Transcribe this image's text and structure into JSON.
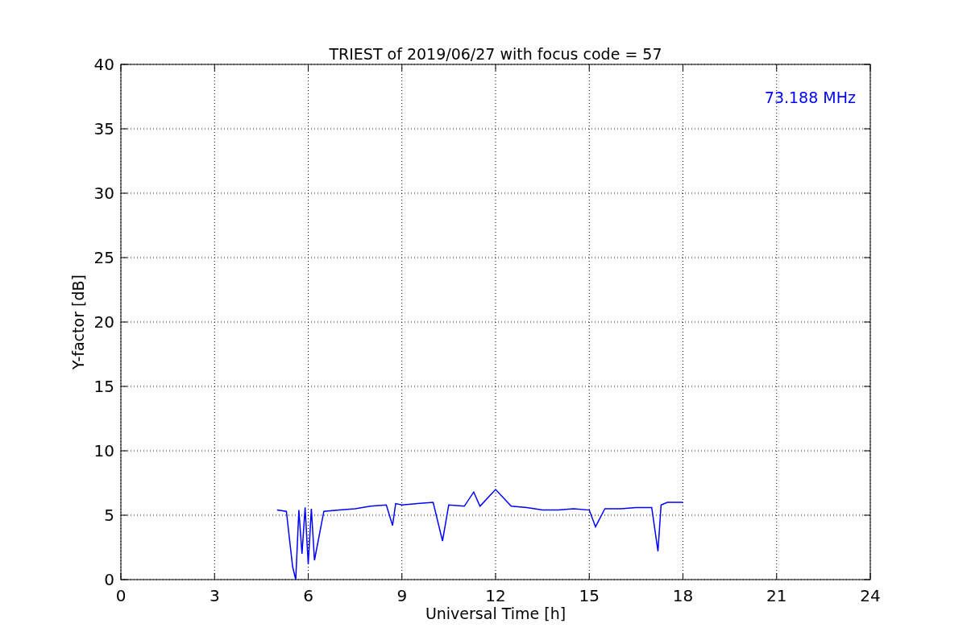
{
  "figure": {
    "chart_data": {
      "type": "line",
      "title": "TRIEST of 2019/06/27 with focus code = 57",
      "xlabel": "Universal Time [h]",
      "ylabel": "Y-factor [dB]",
      "x": [
        5.0,
        5.3,
        5.5,
        5.6,
        5.7,
        5.8,
        5.9,
        6.0,
        6.1,
        6.2,
        6.5,
        7.0,
        7.5,
        8.0,
        8.5,
        8.7,
        8.8,
        9.0,
        9.5,
        10.0,
        10.3,
        10.5,
        11.0,
        11.3,
        11.5,
        12.0,
        12.5,
        13.0,
        13.5,
        14.0,
        14.5,
        15.0,
        15.2,
        15.5,
        16.0,
        16.5,
        17.0,
        17.2,
        17.3,
        17.5,
        18.0
      ],
      "grid": true,
      "series": [
        {
          "color": "#0000ff",
          "values": [
            5.4,
            5.3,
            1.0,
            0,
            5.4,
            2.0,
            5.6,
            1.2,
            5.5,
            1.5,
            5.3,
            5.4,
            5.5,
            5.7,
            5.8,
            4.2,
            5.9,
            5.8,
            5.9,
            6.0,
            3.0,
            5.8,
            5.7,
            6.8,
            5.7,
            7.0,
            5.7,
            5.6,
            5.4,
            5.4,
            5.5,
            5.4,
            4.1,
            5.5,
            5.5,
            5.6,
            5.6,
            2.2,
            5.8,
            6.0,
            6.0
          ]
        }
      ],
      "xlim": [
        0,
        24
      ],
      "ylim": [
        0,
        40
      ],
      "xticks": [
        0,
        3,
        6,
        9,
        12,
        15,
        18,
        21,
        24
      ],
      "yticks": [
        0,
        5,
        10,
        15,
        20,
        25,
        30,
        35,
        40
      ],
      "annotations": [
        {
          "text": "73.188 MHz"
        }
      ]
    }
  }
}
